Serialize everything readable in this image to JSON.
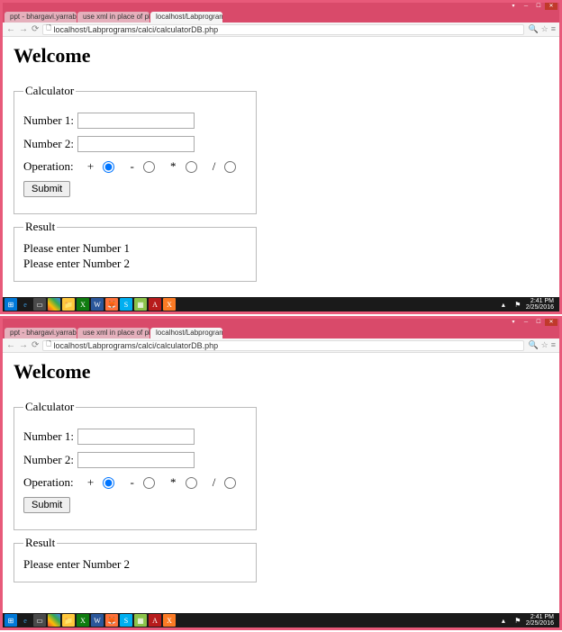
{
  "common": {
    "url": "localhost/Labprograms/calci/calculatorDB.php",
    "tabs": [
      {
        "label": "ppt - bhargavi.yarrabally",
        "icon": "#d93025"
      },
      {
        "label": "use xml in place of php f",
        "icon": "#4285f4"
      },
      {
        "label": "localhost/Labprograms/c",
        "icon": "#f29900",
        "active": true
      }
    ],
    "heading": "Welcome",
    "calc_legend": "Calculator",
    "num1_label": "Number 1:",
    "num2_label": "Number 2:",
    "op_label": "Operation:",
    "op_plus": "+",
    "op_minus": "-",
    "op_mult": "*",
    "op_div": "/",
    "submit": "Submit",
    "result_legend": "Result",
    "clock_time": "2:41 PM",
    "clock_date": "2/25/2016"
  },
  "shot1": {
    "result_lines": [
      "Please enter Number 1",
      "Please enter Number 2"
    ]
  },
  "shot2": {
    "result_lines": [
      "Please enter Number 2"
    ]
  }
}
